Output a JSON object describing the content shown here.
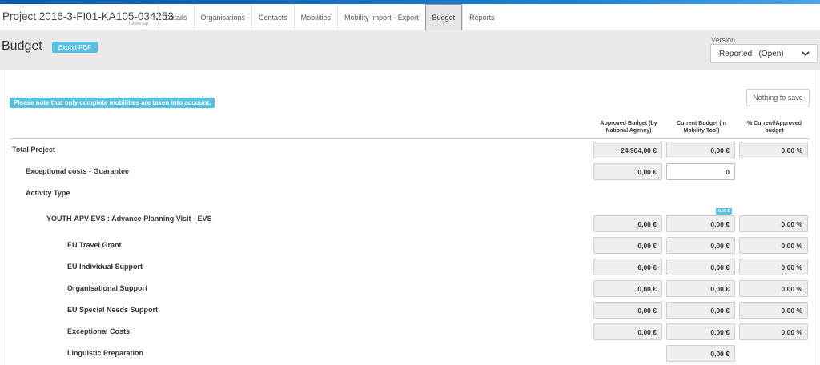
{
  "header": {
    "project_title": "Project 2016-3-FI01-KA105-034253",
    "project_subtitle": "follow-up",
    "tabs": [
      {
        "label": "Details",
        "active": false
      },
      {
        "label": "Organisations",
        "active": false
      },
      {
        "label": "Contacts",
        "active": false
      },
      {
        "label": "Mobilities",
        "active": false
      },
      {
        "label": "Mobility Import - Export",
        "active": false
      },
      {
        "label": "Budget",
        "active": true
      },
      {
        "label": "Reports",
        "active": false
      }
    ]
  },
  "subheader": {
    "page_title": "Budget",
    "export_label": "Export PDF",
    "version_label": "Version",
    "version_value": "Reported   (Open)"
  },
  "notice": "Please note that only complete mobilities are taken into account.",
  "save_label": "Nothing to save",
  "columns": {
    "approved": "Approved Budget (by National Agency)",
    "current": "Current Budget (in Mobility Tool)",
    "percent": "% Current/Approved budget"
  },
  "rows": {
    "total": {
      "label": "Total Project",
      "approved": "24.904,00 €",
      "current": "0,00 €",
      "percent": "0.00 %"
    },
    "exceptional_guarantee": {
      "label": "Exceptional costs - Guarantee",
      "approved": "0,00 €",
      "current": "0"
    },
    "activity_type": {
      "label": "Activity Type"
    },
    "youth_apv": {
      "label": "YOUTH-APV-EVS : Advance Planning Visit - EVS",
      "badge": "0,00 €",
      "approved": "0,00 €",
      "current": "0,00 €",
      "percent": "0.00 %"
    },
    "travel": {
      "label": "EU Travel Grant",
      "approved": "0,00 €",
      "current": "0,00 €",
      "percent": "0.00 %"
    },
    "individual": {
      "label": "EU Individual Support",
      "approved": "0,00 €",
      "current": "0,00 €",
      "percent": "0.00 %"
    },
    "organisational": {
      "label": "Organisational Support",
      "approved": "0,00 €",
      "current": "0,00 €",
      "percent": "0.00 %"
    },
    "special_needs": {
      "label": "EU Special Needs Support",
      "approved": "0,00 €",
      "current": "0,00 €",
      "percent": "0.00 %"
    },
    "exceptional": {
      "label": "Exceptional Costs",
      "approved": "0,00 €",
      "current": "0,00 €",
      "percent": "0.00 %"
    },
    "linguistic": {
      "label": "Linguistic Preparation",
      "current": "0,00 €"
    }
  },
  "colors": {
    "accent": "#5bc0de",
    "topbar": "#1e7fd0",
    "cell_bg": "#eeeeee"
  }
}
